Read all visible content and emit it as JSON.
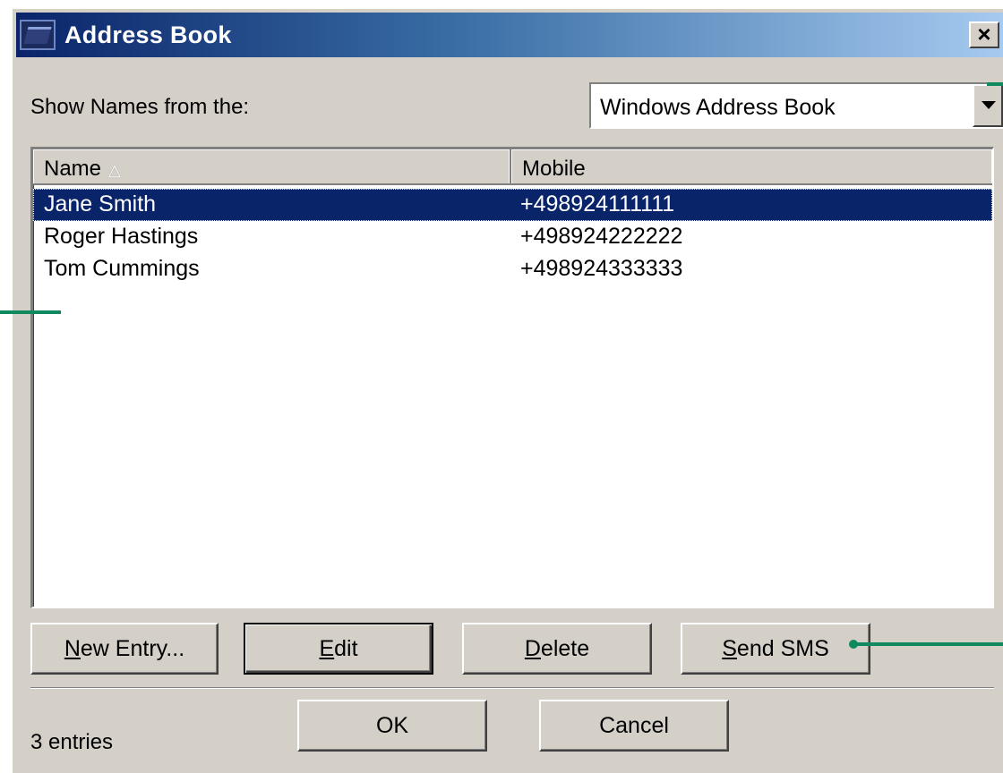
{
  "window": {
    "title": "Address Book",
    "close_label": "×"
  },
  "source": {
    "label": "Show Names from the:",
    "selected": "Windows Address Book"
  },
  "list": {
    "columns": [
      "Name",
      "Mobile"
    ],
    "sort_indicator": "△",
    "rows": [
      {
        "name": "Jane Smith",
        "mobile": "+498924111111",
        "selected": true
      },
      {
        "name": "Roger Hastings",
        "mobile": "+498924222222",
        "selected": false
      },
      {
        "name": "Tom Cummings",
        "mobile": "+498924333333",
        "selected": false
      }
    ]
  },
  "buttons": {
    "new_entry": {
      "mnemonic": "N",
      "rest": "ew Entry..."
    },
    "edit": {
      "mnemonic": "E",
      "rest": "dit"
    },
    "delete": {
      "mnemonic": "D",
      "rest": "elete"
    },
    "send_sms": {
      "mnemonic": "S",
      "rest": "end SMS"
    },
    "ok": "OK",
    "cancel": "Cancel"
  },
  "status": "3 entries",
  "colors": {
    "selection": "#0a246a",
    "dialog_face": "#d4d0c8",
    "callout": "#0f8a5f"
  }
}
